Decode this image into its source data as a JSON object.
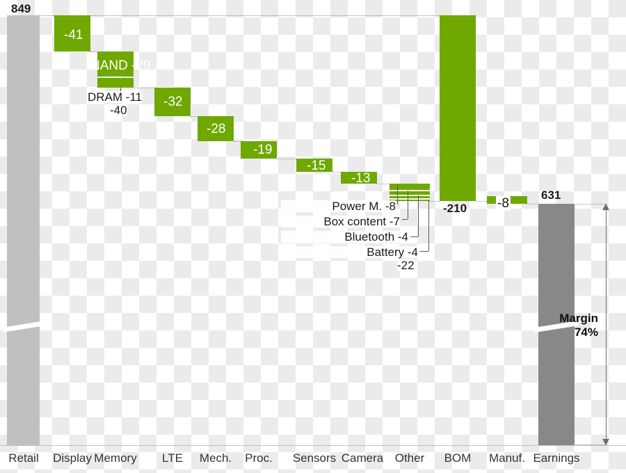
{
  "chart_data": {
    "type": "bar",
    "subtype": "waterfall",
    "title": "",
    "xlabel": "",
    "ylabel": "",
    "ylim": [
      0,
      849
    ],
    "grid": false,
    "legend": "none",
    "categories": [
      "Retail",
      "Display",
      "Memory",
      "LTE",
      "Mech.",
      "Proc.",
      "Sensors",
      "Camera",
      "Other",
      "BOM",
      "Manuf.",
      "Earnings"
    ],
    "values": [
      849,
      -41,
      -40,
      -32,
      -28,
      -19,
      -15,
      -13,
      -22,
      -210,
      -8,
      631
    ],
    "bar_labels": [
      "849",
      "-41",
      "-40",
      "-32",
      "-28",
      "-19",
      "-15",
      "-13",
      "-22",
      "-210",
      "-8",
      "631"
    ],
    "bar_types": [
      "total",
      "decrease",
      "decrease",
      "decrease",
      "decrease",
      "decrease",
      "decrease",
      "decrease",
      "decrease",
      "decrease",
      "decrease",
      "total"
    ],
    "running_totals": [
      849,
      808,
      768,
      736,
      708,
      689,
      674,
      661,
      639,
      429,
      631,
      631
    ],
    "breakdowns": [
      {
        "category": "Memory",
        "items": [
          {
            "label": "NAND",
            "value": -29
          },
          {
            "label": "DRAM",
            "value": -11
          }
        ],
        "total_label": "-40"
      },
      {
        "category": "Other",
        "items": [
          {
            "label": "Power M.",
            "value": -8
          },
          {
            "label": "Box content",
            "value": -7
          },
          {
            "label": "Bluetooth",
            "value": -4
          },
          {
            "label": "Battery",
            "value": -4
          }
        ],
        "total_label": "-22"
      }
    ],
    "annotations": [
      {
        "name": "margin",
        "lines": [
          "Margin",
          "74%"
        ],
        "value": 74,
        "unit": "%"
      }
    ],
    "colors": {
      "decrease": "#6ea800",
      "total_start": "#c0c0c0",
      "total_end": "#888888",
      "text": "#1a1a1a",
      "connector": "#9a9a9a"
    },
    "axis_break": true
  },
  "labels": {
    "start_total": "849",
    "end_total": "631",
    "bom": "-210",
    "manuf": "-8",
    "display": "-41",
    "memory_total": "-40",
    "memory_nand": "NAND -29",
    "memory_dram": "DRAM -11",
    "lte": "-32",
    "mech": "-28",
    "proc": "-19",
    "sensors": "-15",
    "camera": "-13",
    "other_total": "-22",
    "other_power": "Power M. -8",
    "other_box": "Box content -7",
    "other_bluetooth": "Bluetooth -4",
    "other_battery": "Battery -4",
    "margin_title": "Margin",
    "margin_value": "74%"
  },
  "axis": {
    "categories": [
      {
        "label": "Retail"
      },
      {
        "label": "Display"
      },
      {
        "label": "Memory"
      },
      {
        "label": "LTE"
      },
      {
        "label": "Mech."
      },
      {
        "label": "Proc."
      },
      {
        "label": "Sensors"
      },
      {
        "label": "Camera"
      },
      {
        "label": "Other"
      },
      {
        "label": "BOM"
      },
      {
        "label": "Manuf."
      },
      {
        "label": "Earnings"
      }
    ]
  }
}
